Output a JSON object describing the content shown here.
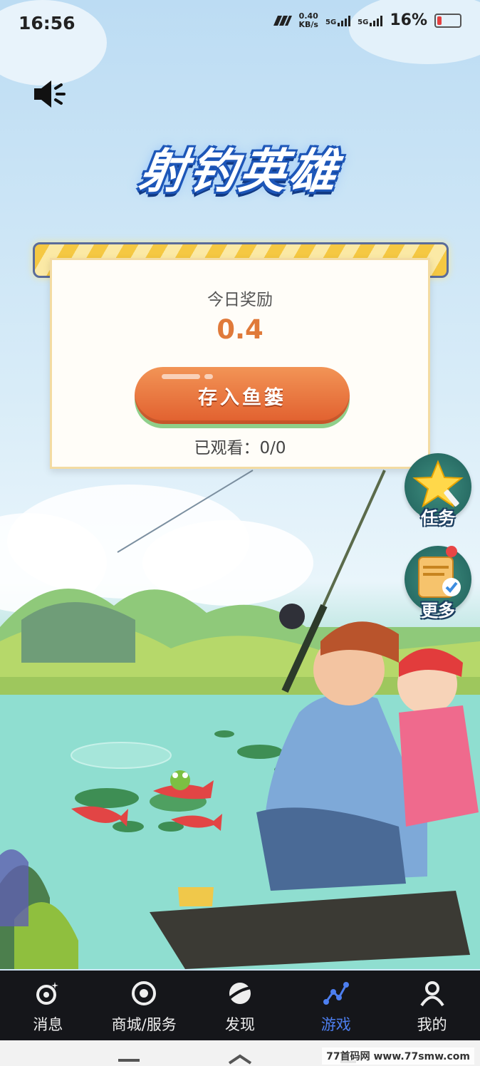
{
  "status_bar": {
    "time": "16:56",
    "speed_value": "0.40",
    "speed_unit": "KB/s",
    "net1": "5G",
    "net2": "5G",
    "battery": "16%"
  },
  "game": {
    "title": "射钓英雄",
    "reward_label": "今日奖励",
    "reward_value": "0.4",
    "deposit_button": "存入鱼篓",
    "watched_text": "已观看：0/0",
    "side_buttons": {
      "tasks": "任务",
      "more": "更多"
    }
  },
  "nav": {
    "items": [
      {
        "label": "消息",
        "icon": "message-planet-icon"
      },
      {
        "label": "商城/服务",
        "icon": "mall-ring-icon"
      },
      {
        "label": "发现",
        "icon": "discover-planet-icon"
      },
      {
        "label": "游戏",
        "icon": "game-chart-icon",
        "active": true
      },
      {
        "label": "我的",
        "icon": "profile-icon"
      }
    ],
    "active_color": "#4d7ff0"
  },
  "watermark": "77首码网 www.77smw.com"
}
